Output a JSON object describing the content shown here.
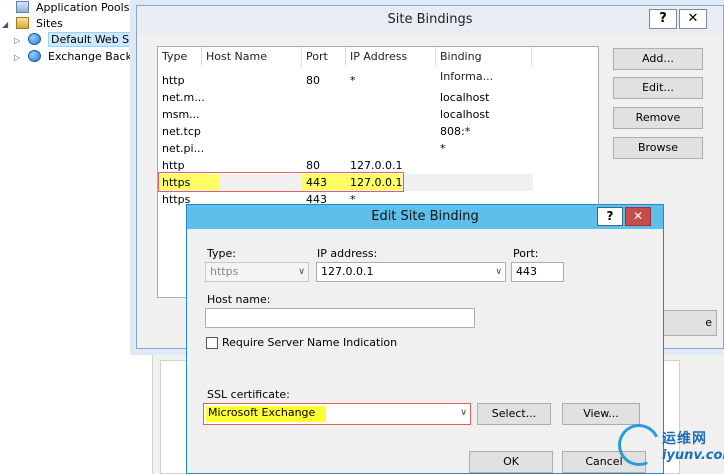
{
  "tree": {
    "items": [
      {
        "label": "Application Pools",
        "icon": "app-pool-icon"
      },
      {
        "label": "Sites",
        "icon": "sites-folder-icon"
      },
      {
        "label": "Default Web Site",
        "icon": "globe-icon"
      },
      {
        "label": "Exchange Back End",
        "icon": "globe-icon"
      }
    ]
  },
  "site_bindings": {
    "title": "Site Bindings",
    "help_label": "?",
    "close_label": "✕",
    "columns": [
      "Type",
      "Host Name",
      "Port",
      "IP Address",
      "Binding Informa..."
    ],
    "rows": [
      [
        "http",
        "",
        "80",
        "*",
        ""
      ],
      [
        "net.m...",
        "",
        "",
        "",
        "localhost"
      ],
      [
        "msm...",
        "",
        "",
        "",
        "localhost"
      ],
      [
        "net.tcp",
        "",
        "",
        "",
        "808:*"
      ],
      [
        "net.pi...",
        "",
        "",
        "",
        "*"
      ],
      [
        "http",
        "",
        "80",
        "127.0.0.1",
        ""
      ],
      [
        "https",
        "",
        "443",
        "127.0.0.1",
        ""
      ],
      [
        "https",
        "",
        "443",
        "*",
        ""
      ]
    ],
    "selected_row": 6,
    "buttons": {
      "add": "Add...",
      "edit": "Edit...",
      "remove": "Remove",
      "browse": "Browse"
    },
    "close_button_partial": "e"
  },
  "edit_binding": {
    "title": "Edit Site Binding",
    "help_label": "?",
    "close_label": "✕",
    "type_label": "Type:",
    "type_value": "https",
    "ip_label": "IP address:",
    "ip_value": "127.0.0.1",
    "port_label": "Port:",
    "port_value": "443",
    "host_label": "Host name:",
    "host_value": "",
    "sni_label": "Require Server Name Indication",
    "sni_checked": false,
    "ssl_label": "SSL certificate:",
    "ssl_value": "Microsoft Exchange",
    "select_button": "Select...",
    "view_button": "View...",
    "ok_button": "OK",
    "cancel_button": "Cancel"
  },
  "watermark": {
    "line1": "运维网",
    "line2": "iyunv.com"
  },
  "colors": {
    "highlight": "#ffff33",
    "highlight_border": "#e06060",
    "dialog_title_active": "#5ec0ea"
  }
}
